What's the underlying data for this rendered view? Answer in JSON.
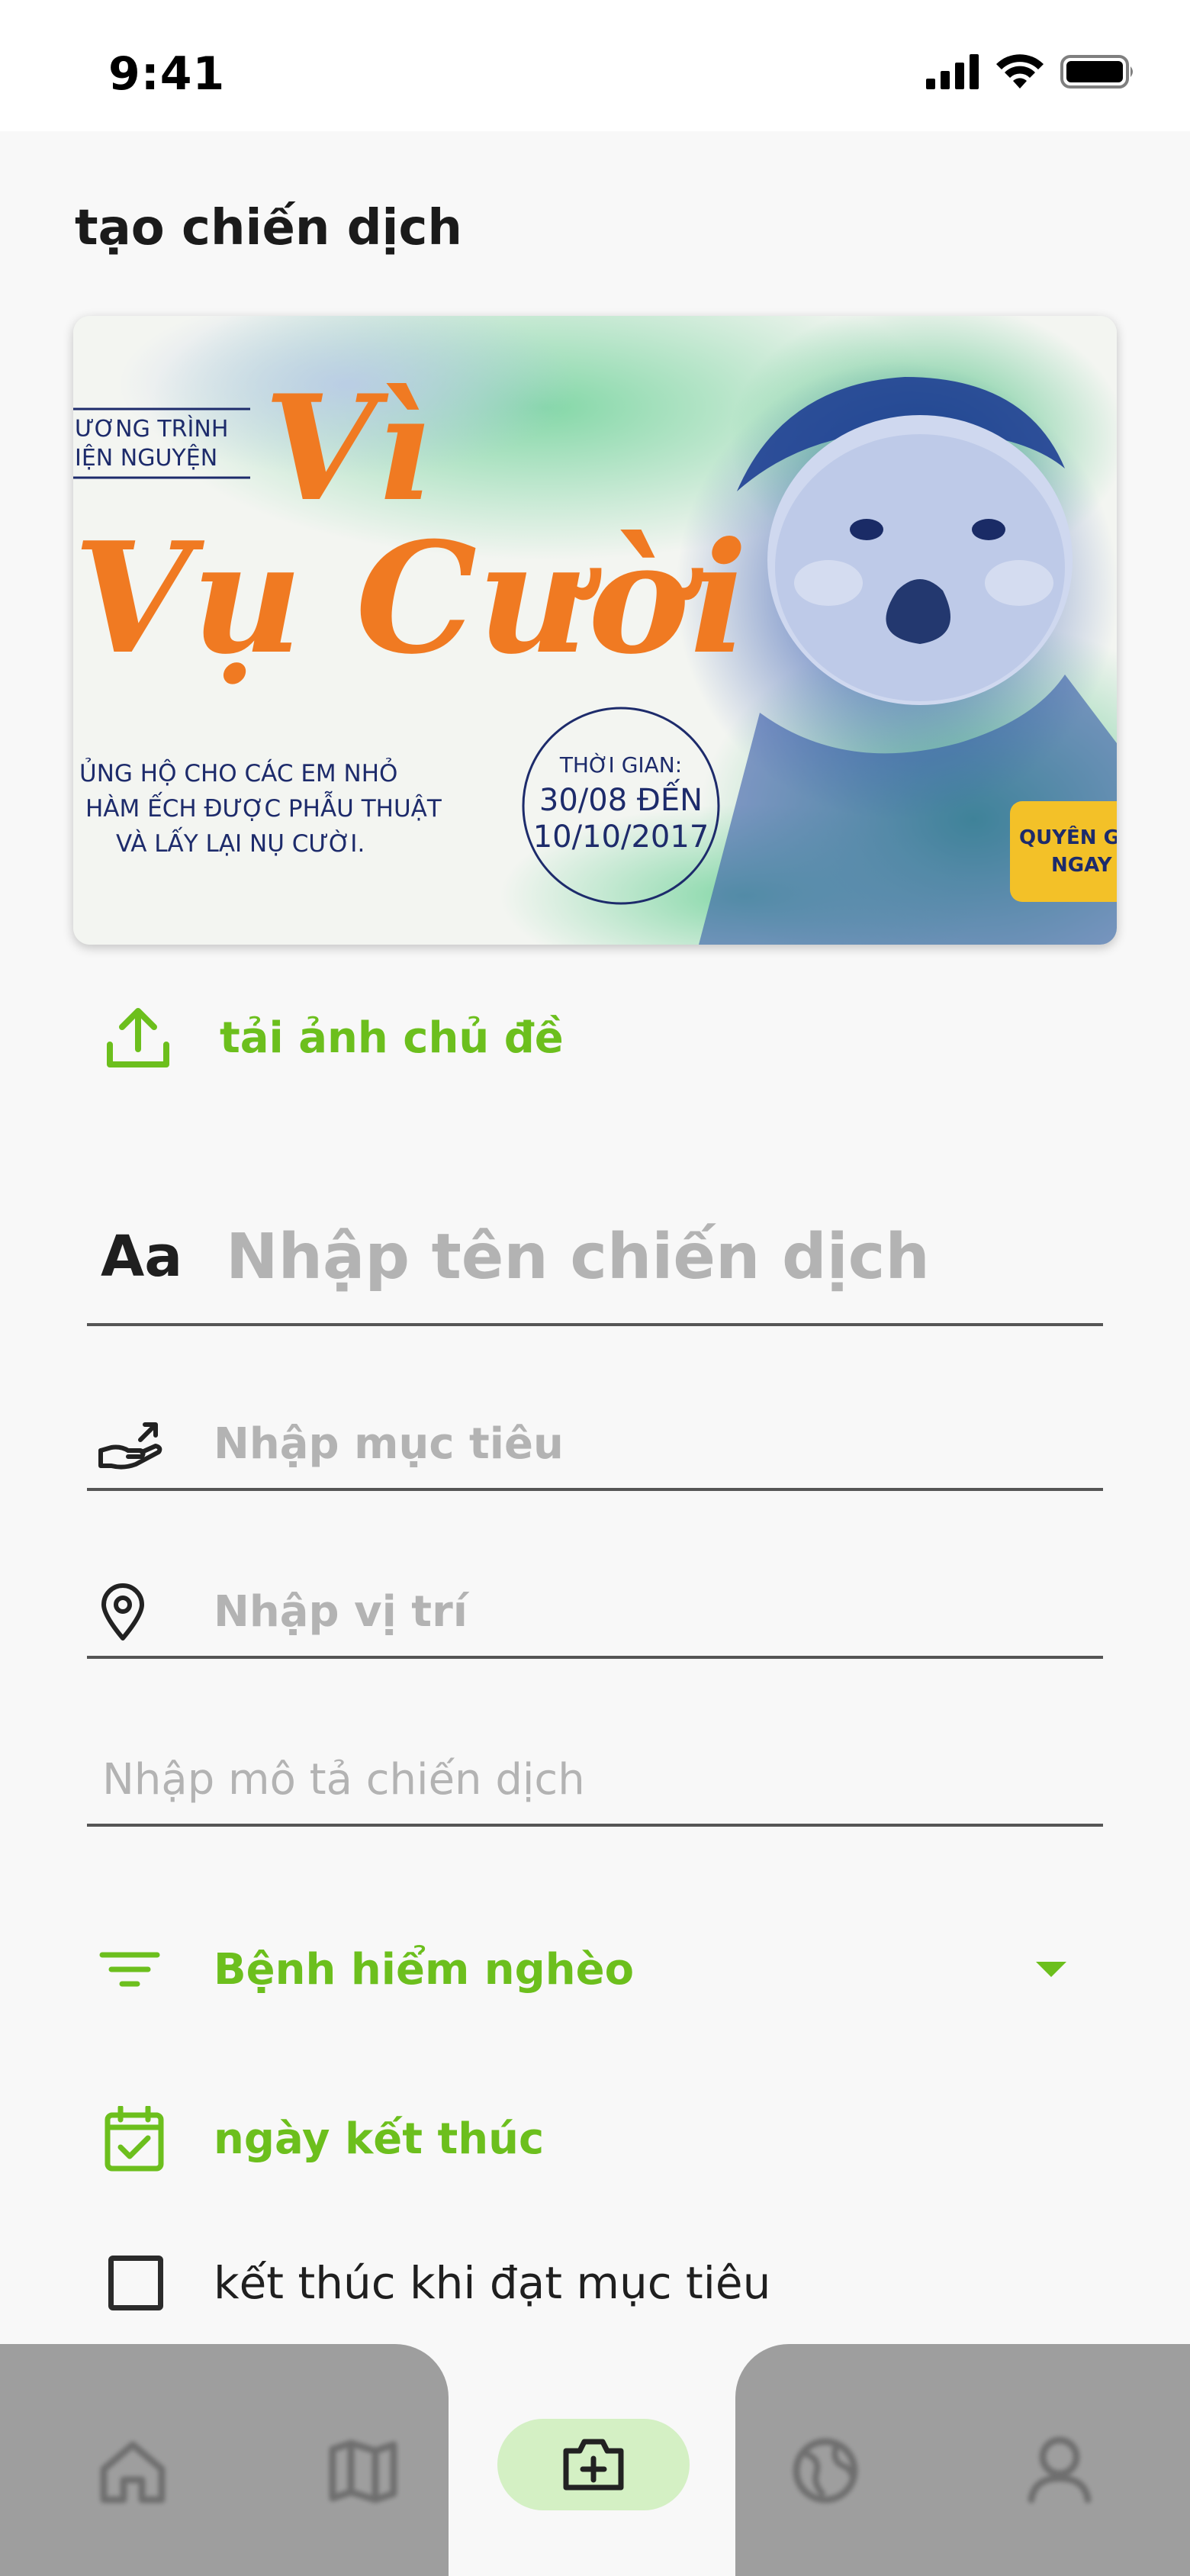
{
  "status_bar": {
    "time": "9:41"
  },
  "page": {
    "title": "tạo chiến dịch"
  },
  "banner": {
    "program_line1": "ƯƠNG TRÌNH",
    "program_line2": "IỆN NGUYỆN",
    "title_line1": "Vì",
    "title_line2": "Vụ Cười",
    "tagline_line1": "ỦNG HỘ CHO CÁC EM NHỎ",
    "tagline_line2": "HÀM ẾCH ĐƯỢC PHẪU THUẬT",
    "tagline_line3": "VÀ LẤY LẠI NỤ CƯỜI.",
    "time_label": "THỜI GIAN:",
    "time_range_line1": "30/08 ĐẾN",
    "time_range_line2": "10/10/2017",
    "donate_line1": "QUYÊN G",
    "donate_line2": "NGAY"
  },
  "upload": {
    "label": "tải ảnh chủ đề",
    "icon": "upload-icon"
  },
  "form": {
    "name": {
      "prefix": "Aa",
      "placeholder": "Nhập tên chiến dịch"
    },
    "goal": {
      "placeholder": "Nhập mục tiêu",
      "icon": "hand-give-icon"
    },
    "location": {
      "placeholder": "Nhập vị trí",
      "icon": "location-pin-icon"
    },
    "description": {
      "placeholder": "Nhập mô tả chiến dịch"
    },
    "category": {
      "selected": "Bệnh hiểm nghèo",
      "icon": "filter-icon"
    },
    "end_date": {
      "label": "ngày kết thúc",
      "icon": "calendar-check-icon"
    },
    "end_on_goal": {
      "label": "kết thúc khi đạt mục tiêu",
      "checked": false
    }
  },
  "nav": {
    "items": [
      "home-icon",
      "map-icon",
      "create-campaign-icon",
      "globe-icon",
      "profile-icon"
    ],
    "active": "create-campaign-icon"
  },
  "colors": {
    "accent": "#6cbf1d",
    "pill": "#d4f0c4",
    "nav_bg": "#9e9e9e"
  }
}
